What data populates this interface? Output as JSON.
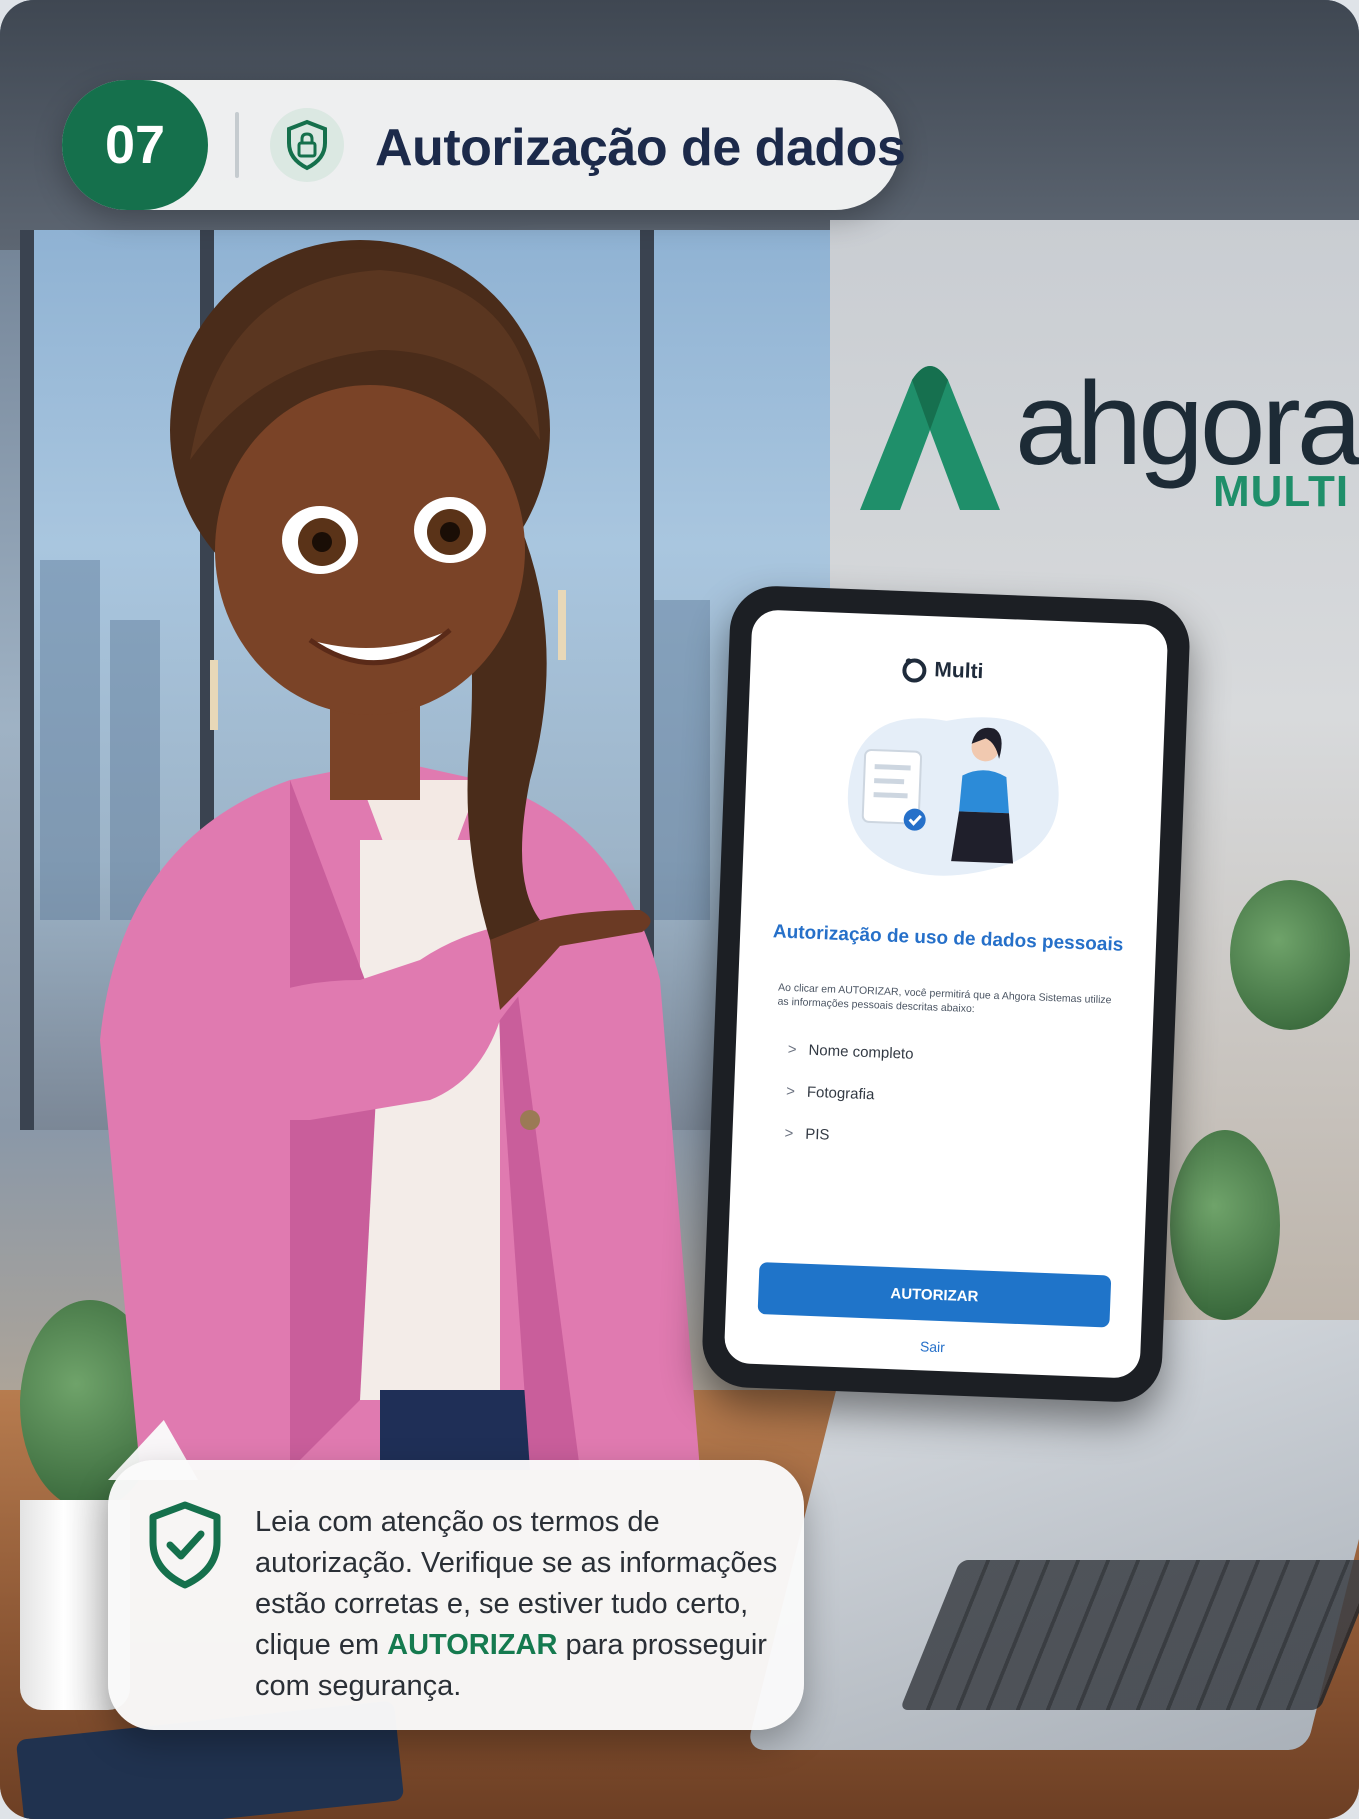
{
  "header": {
    "step_number": "07",
    "title": "Autorização de dados"
  },
  "brand": {
    "name": "ahgora",
    "sub": "MULTI",
    "accent": "#1f8f6a",
    "dark": "#1d2b36"
  },
  "tablet": {
    "app_logo_label": "Multi",
    "title": "Autorização de uso de dados pessoais",
    "description": "Ao clicar em AUTORIZAR, você permitirá que a Ahgora Sistemas utilize as informações pessoais descritas abaixo:",
    "fields": [
      "Nome completo",
      "Fotografia",
      "PIS"
    ],
    "authorize_button": "AUTORIZAR",
    "exit_link": "Sair",
    "button_color": "#1f74c9"
  },
  "tip": {
    "text_before": "Leia com atenção os termos de autorização. Verifique se as informações estão corretas e, se estiver tudo certo, clique em ",
    "emphasis": "AUTORIZAR",
    "text_after": " para prosseguir com segurança.",
    "icon": "shield-check-icon"
  },
  "colors": {
    "primary_green": "#15704c",
    "navy": "#1c2a4a"
  }
}
